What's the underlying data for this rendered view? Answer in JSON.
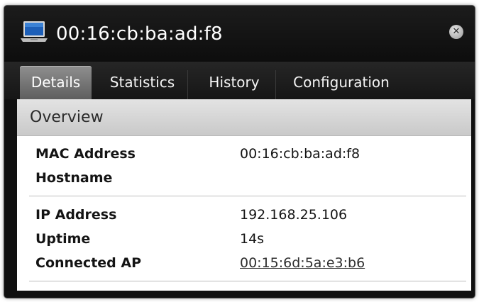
{
  "window": {
    "title": "00:16:cb:ba:ad:f8",
    "icon": "laptop-icon",
    "close_icon": "close-icon"
  },
  "tabs": [
    {
      "label": "Details",
      "active": true
    },
    {
      "label": "Statistics",
      "active": false
    },
    {
      "label": "History",
      "active": false
    },
    {
      "label": "Configuration",
      "active": false
    }
  ],
  "overview": {
    "title": "Overview",
    "group1": [
      {
        "label": "MAC Address",
        "value": "00:16:cb:ba:ad:f8"
      },
      {
        "label": "Hostname",
        "value": ""
      }
    ],
    "group2": [
      {
        "label": "IP Address",
        "value": "192.168.25.106"
      },
      {
        "label": "Uptime",
        "value": "14s"
      },
      {
        "label": "Connected AP",
        "value": "00:15:6d:5a:e3:b6"
      }
    ]
  },
  "colors": {
    "window_bg": "#101010",
    "active_tab": "#7a7a7a",
    "section_header": "#d6d6d6"
  }
}
